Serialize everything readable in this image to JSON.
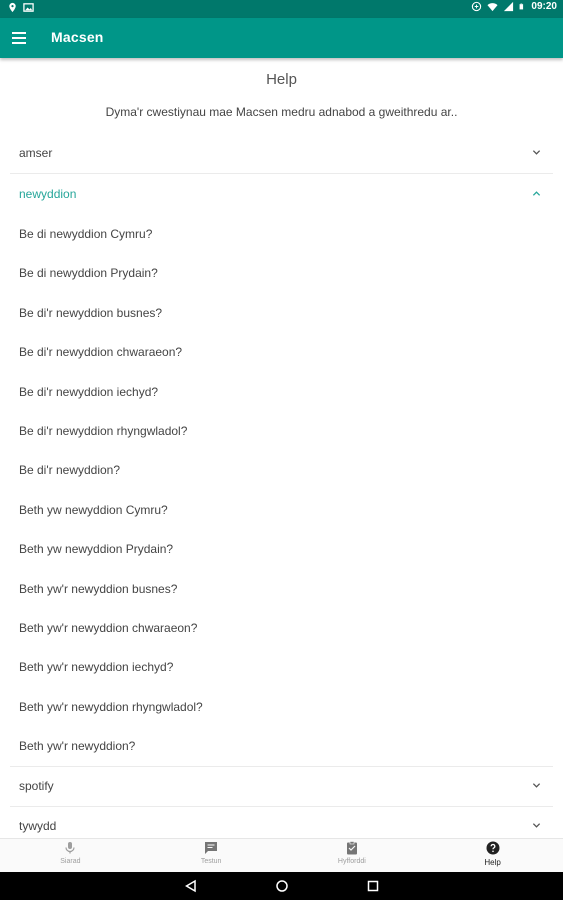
{
  "status_bar": {
    "time": "09:20",
    "icons_left": [
      "location-icon",
      "image-icon"
    ],
    "icons_right": [
      "sync-icon",
      "wifi-icon",
      "signal-icon",
      "battery-icon"
    ]
  },
  "app_bar": {
    "title": "Macsen",
    "menu_icon": "menu-icon"
  },
  "page": {
    "heading": "Help",
    "subheading": "Dyma'r cwestiynau mae Macsen medru adnabod a gweithredu ar.."
  },
  "topics": [
    {
      "label": "amser",
      "expanded": false
    },
    {
      "label": "newyddion",
      "expanded": true,
      "questions": [
        "Be di newyddion Cymru?",
        "Be di newyddion Prydain?",
        "Be di'r newyddion busnes?",
        "Be di'r newyddion chwaraeon?",
        "Be di'r newyddion iechyd?",
        "Be di'r newyddion rhyngwladol?",
        "Be di'r newyddion?",
        "Beth yw newyddion Cymru?",
        "Beth yw newyddion Prydain?",
        "Beth yw'r newyddion busnes?",
        "Beth yw'r newyddion chwaraeon?",
        "Beth yw'r newyddion iechyd?",
        "Beth yw'r newyddion rhyngwladol?",
        "Beth yw'r newyddion?"
      ]
    },
    {
      "label": "spotify",
      "expanded": false
    },
    {
      "label": "tywydd",
      "expanded": false
    }
  ],
  "bottom_nav": [
    {
      "label": "Siarad",
      "icon": "microphone-icon",
      "active": false
    },
    {
      "label": "Testun",
      "icon": "chat-icon",
      "active": false
    },
    {
      "label": "Hyfforddi",
      "icon": "clipboard-icon",
      "active": false
    },
    {
      "label": "Help",
      "icon": "help-icon",
      "active": true
    }
  ],
  "colors": {
    "status_bar": "#00786b",
    "app_bar": "#009688",
    "accent": "#26a69a"
  }
}
